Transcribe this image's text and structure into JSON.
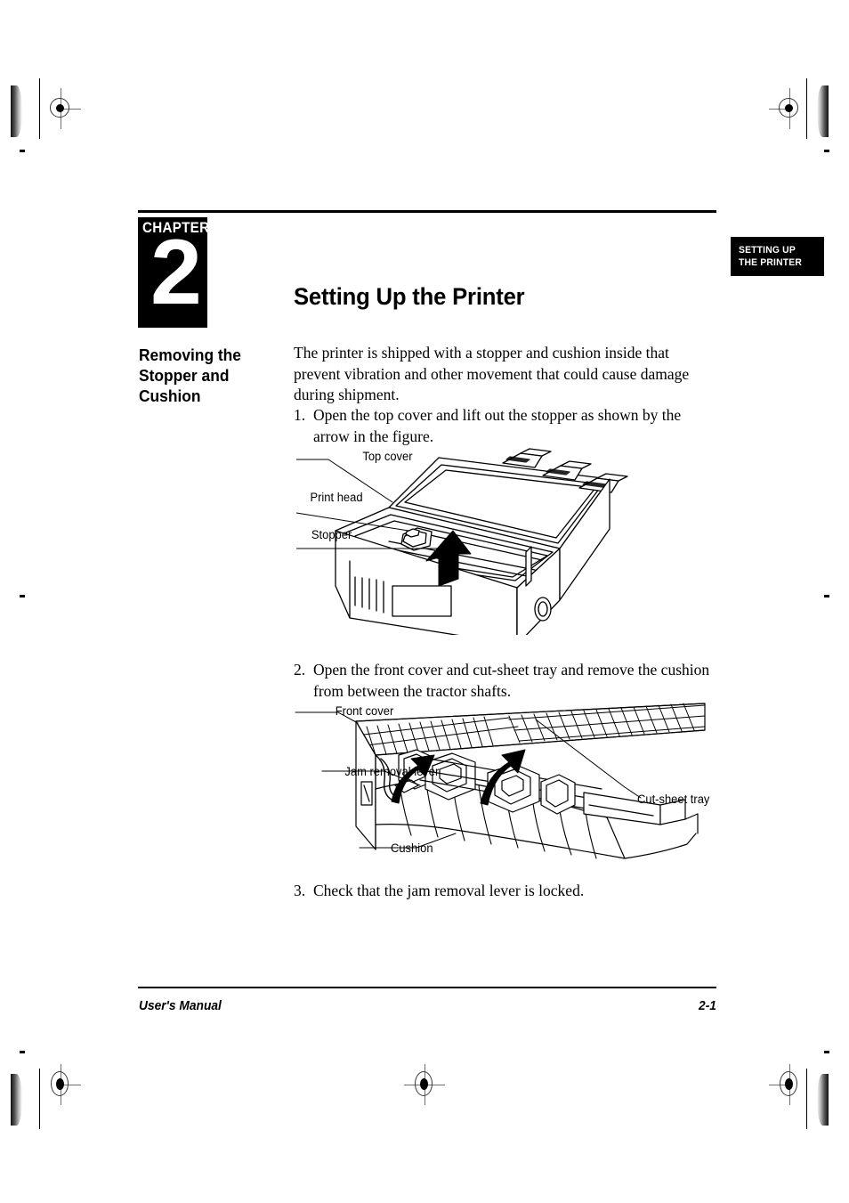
{
  "chapter": {
    "word": "CHAPTER",
    "number": "2"
  },
  "side_tab": {
    "line1": "SETTING UP",
    "line2": "THE PRINTER"
  },
  "title": "Setting Up the Printer",
  "section_heading": "Removing the Stopper and Cushion",
  "intro_paragraph": "The printer is shipped with a stopper and cushion inside that prevent vibration and other movement that could cause damage during shipment.",
  "steps": [
    {
      "number": "1.",
      "text": "Open the top cover and lift out the stopper as shown by the arrow in the figure."
    },
    {
      "number": "2.",
      "text": "Open the front cover and cut-sheet tray and remove the cushion from between the tractor shafts."
    },
    {
      "number": "3.",
      "text": "Check that the jam removal lever is locked."
    }
  ],
  "figure1": {
    "name": "printer-top-cover-open-illustration",
    "labels": {
      "top_cover": "Top cover",
      "print_head": "Print head",
      "stopper": "Stopper"
    }
  },
  "figure2": {
    "name": "printer-front-cover-cushion-illustration",
    "labels": {
      "front_cover": "Front cover",
      "jam_removal_lever": "Jam removal lever",
      "cushion": "Cushion",
      "cut_sheet_tray": "Cut-sheet tray"
    }
  },
  "footer": {
    "left": "User's Manual",
    "right": "2-1"
  },
  "colors": {
    "ink": "#000000",
    "paper": "#ffffff",
    "registration": "#6f6f6f"
  }
}
